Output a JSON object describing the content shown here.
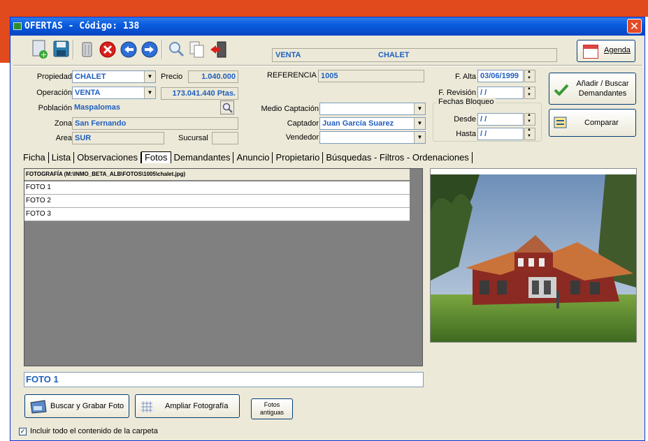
{
  "window": {
    "title": "OFERTAS  -  Código: 138"
  },
  "banner": {
    "operacion": "VENTA",
    "propiedad": "CHALET"
  },
  "agenda": {
    "label": "Agenda"
  },
  "form": {
    "propiedad": {
      "label": "Propiedad",
      "value": "CHALET"
    },
    "precio": {
      "label": "Precio",
      "value": "1.040.000"
    },
    "operacion": {
      "label": "Operación",
      "value": "VENTA"
    },
    "ptas": {
      "value": "173.041.440 Ptas."
    },
    "poblacion": {
      "label": "Población",
      "value": "Maspalomas"
    },
    "zona": {
      "label": "Zona",
      "value": "San Fernando"
    },
    "area": {
      "label": "Area",
      "value": "SUR"
    },
    "sucursal": {
      "label": "Sucursal",
      "value": ""
    },
    "referencia": {
      "label": "REFERENCIA",
      "value": "1005"
    },
    "medio_captacion": {
      "label": "Medio Captación",
      "value": ""
    },
    "captador": {
      "label": "Captador",
      "value": "Juan García Suarez"
    },
    "vendedor": {
      "label": "Vendedor",
      "value": ""
    },
    "f_alta": {
      "label": "F. Alta",
      "value": "03/06/1999"
    },
    "f_revision": {
      "label": "F. Revisión",
      "value": "  /  /"
    },
    "fechas_bloqueo": {
      "label": "Fechas Bloqueo"
    },
    "desde": {
      "label": "Desde",
      "value": "  /  /"
    },
    "hasta": {
      "label": "Hasta",
      "value": "  /  /"
    }
  },
  "buttons": {
    "anadir_line1": "Añadir / Buscar",
    "anadir_line2": "Demandantes",
    "comparar": "Comparar",
    "buscar_grabar": "Buscar y Grabar Foto",
    "ampliar": "Ampliar Fotografía",
    "fotos_antiguas_line1": "Fotos",
    "fotos_antiguas_line2": "antiguas"
  },
  "tabs": [
    "Ficha",
    "Lista",
    "Observaciones",
    "Fotos",
    "Demandantes",
    "Anuncio",
    "Propietario",
    "Búsquedas - Filtros - Ordenaciones"
  ],
  "active_tab": "Fotos",
  "photos": {
    "header": "FOTOGRAFÍA (M:\\INMO_BETA_ALB\\FOTOS\\1005\\chalet.jpg)",
    "rows": [
      "FOTO 1",
      "FOTO 2",
      "FOTO 3"
    ],
    "caption": "FOTO 1"
  },
  "include_folder": {
    "label": "Incluir todo el contenido de la carpeta",
    "checked": true
  }
}
